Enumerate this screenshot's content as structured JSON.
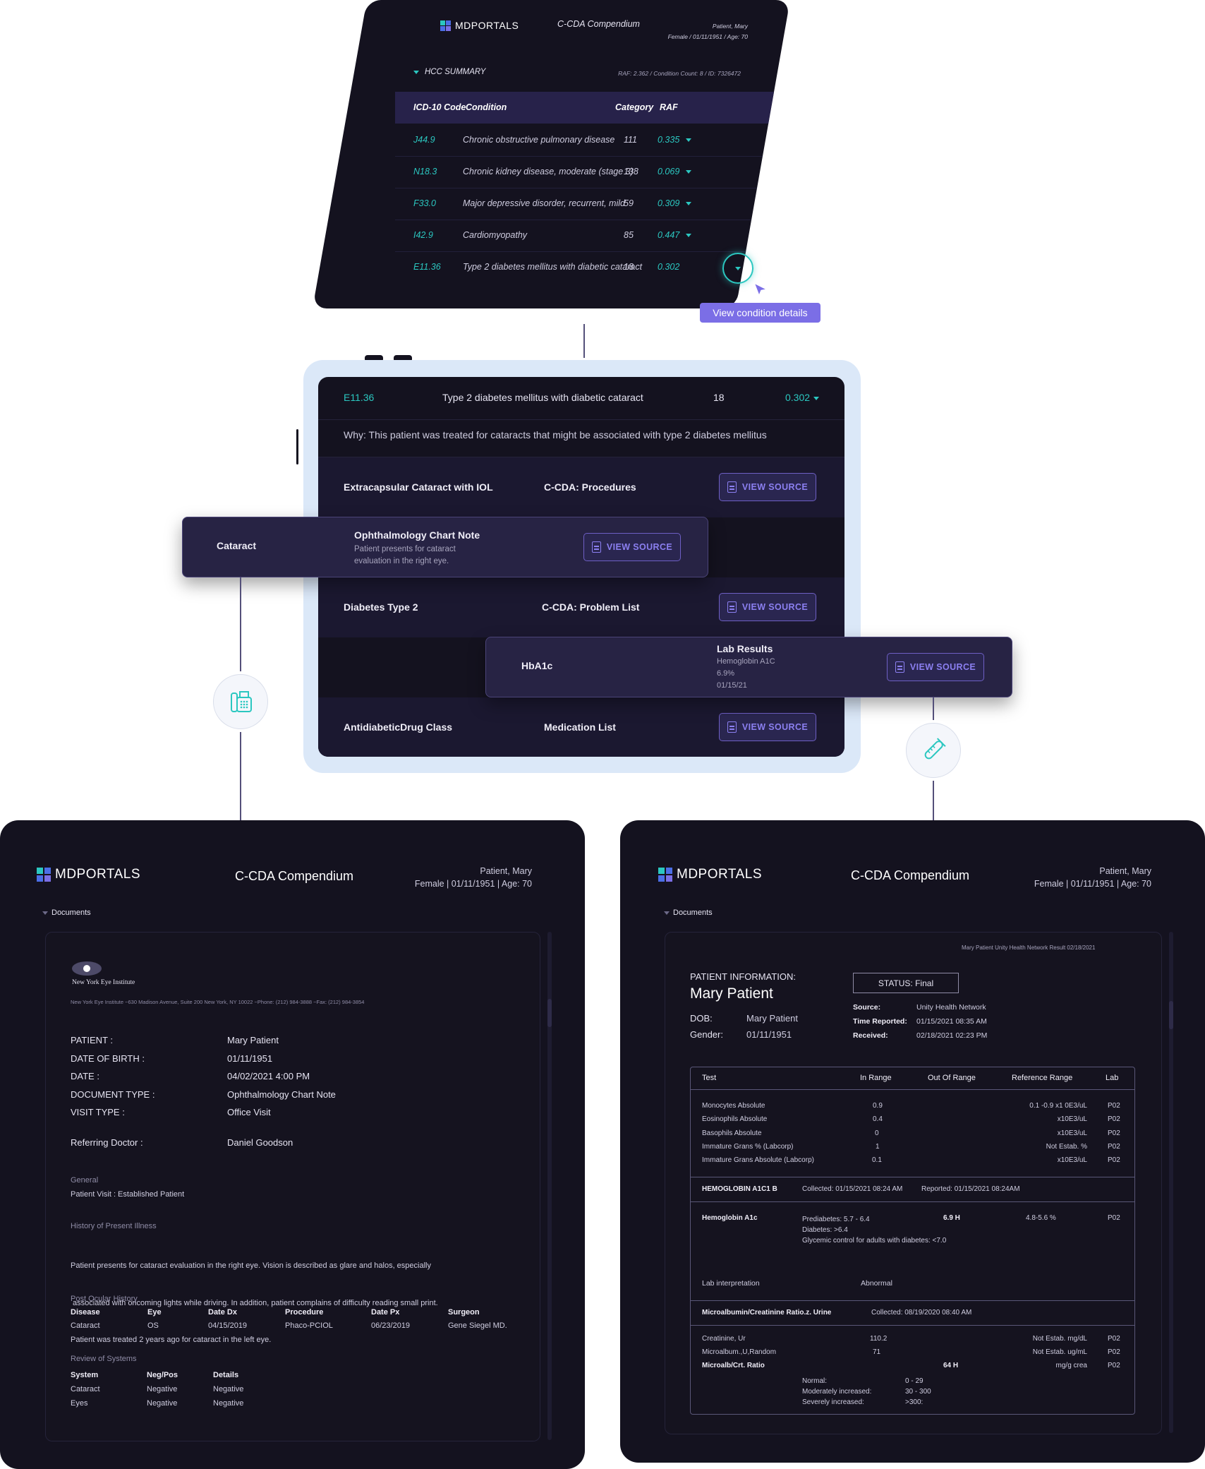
{
  "brand": {
    "name": "MDPORTALS",
    "colors": {
      "bg": "#14121f",
      "accent": "#2bc7c0",
      "purple": "#7b6ee6"
    }
  },
  "hcc": {
    "header_title": "C-CDA Compendium",
    "patient_name": "Patient, Mary",
    "patient_meta": "Female  /  01/11/1951  /  Age: 70",
    "section_label": "HCC SUMMARY",
    "summary_meta": "RAF: 2.362  /  Condition Count: 8  /  ID: 7326472",
    "columns": [
      "ICD-10 Code",
      "Condition",
      "Category",
      "RAF"
    ],
    "rows": [
      {
        "code": "J44.9",
        "condition": "Chronic obstructive pulmonary disease",
        "category": "111",
        "raf": "0.335"
      },
      {
        "code": "N18.3",
        "condition": "Chronic kidney disease, moderate (stage 3)",
        "category": "138",
        "raf": "0.069"
      },
      {
        "code": "F33.0",
        "condition": "Major depressive disorder, recurrent, mild",
        "category": "59",
        "raf": "0.309"
      },
      {
        "code": "I42.9",
        "condition": "Cardiomyopathy",
        "category": "85",
        "raf": "0.447"
      },
      {
        "code": "E11.36",
        "condition": "Type 2 diabetes mellitus with diabetic cataract",
        "category": "18",
        "raf": "0.302"
      }
    ],
    "tooltip": "View condition details"
  },
  "detail": {
    "code": "E11.36",
    "condition": "Type 2 diabetes mellitus with diabetic cataract",
    "category": "18",
    "raf": "0.302",
    "why": "Why: This patient was treated for cataracts that might be associated with type 2 diabetes mellitus",
    "view_source": "VIEW SOURCE",
    "evidence": [
      {
        "name": "Extracapsular Cataract with IOL",
        "source": "C-CDA: Procedures"
      },
      {
        "name": "Diabetes Type 2",
        "source": "C-CDA: Problem List"
      },
      {
        "name": "AntidiabeticDrug Class",
        "source": "Medication List"
      }
    ],
    "pop_cataract": {
      "name": "Cataract",
      "title": "Ophthalmology Chart Note",
      "line1": "Patient presents for cataract",
      "line2": "evaluation in the right eye."
    },
    "pop_hba1c": {
      "name": "HbA1c",
      "title": "Lab Results",
      "line1": "Hemoglobin A1C",
      "line2": "6.9%",
      "line3": "01/15/21"
    }
  },
  "doc_left": {
    "title": "C-CDA Compendium",
    "patient_name": "Patient, Mary",
    "patient_meta": "Female | 01/11/1951 | Age: 70",
    "documents": "Documents",
    "institute": "New York Eye Institute",
    "institute_address": "New York Eye Institute ~630 Madison Avenue, Suite 200 New York, NY 10022 ~Phone: (212) 984-3888 ~Fax: (212) 984-3854",
    "fields": [
      {
        "label": "PATIENT :",
        "value": "Mary Patient"
      },
      {
        "label": "DATE OF BIRTH :",
        "value": "01/11/1951"
      },
      {
        "label": "DATE :",
        "value": "04/02/2021 4:00 PM"
      },
      {
        "label": "DOCUMENT TYPE :",
        "value": "Ophthalmology Chart Note"
      },
      {
        "label": "VISIT TYPE :",
        "value": "Office Visit"
      }
    ],
    "referring_label": "Referring Doctor :",
    "referring_value": "Daniel Goodson",
    "general_label": "General",
    "general_value": "Patient Visit : Established Patient",
    "hpi_label": "History of Present Illness",
    "hpi_lines": [
      "Patient presents for cataract evaluation in the right eye. Vision is described as glare and halos, especially",
      " associated with oncoming lights while driving. In addition, patient complains of difficulty reading small print.",
      "Patient was treated 2 years ago for cataract in the left eye."
    ],
    "poh_label": "Post Ocular History",
    "poh_cols": [
      "Disease",
      "Eye",
      "Date Dx",
      "Procedure",
      "Date Px",
      "Surgeon"
    ],
    "poh_row": [
      "Cataract",
      "OS",
      "04/15/2019",
      "Phaco-PCIOL",
      "06/23/2019",
      "Gene Siegel MD."
    ],
    "ros_label": "Review of Systems",
    "ros_cols": [
      "System",
      "Neg/Pos",
      "Details"
    ],
    "ros_rows": [
      [
        "Cataract",
        "Negative",
        "Negative"
      ],
      [
        "Eyes",
        "Negative",
        "Negative"
      ]
    ]
  },
  "doc_right": {
    "title": "C-CDA Compendium",
    "patient_name": "Patient, Mary",
    "patient_meta": "Female | 01/11/1951 | Age: 70",
    "documents": "Documents",
    "result_header": "Mary Patient Unity Health Network Result 02/18/2021",
    "pi_label": "PATIENT INFORMATION:",
    "name": "Mary Patient",
    "dob_label": "DOB:",
    "dob_value": "Mary Patient",
    "gender_label": "Gender:",
    "gender_value": "01/11/1951",
    "status": "STATUS: Final",
    "source_label": "Source:",
    "source_value": "Unity Health Network",
    "time_label": "Time Reported:",
    "time_value": "01/15/2021 08:35 AM",
    "received_label": "Received:",
    "received_value": "02/18/2021 02:23 PM",
    "table_cols": [
      "Test",
      "In Range",
      "Out Of Range",
      "Reference Range",
      "Lab"
    ],
    "rows1": [
      [
        "Monocytes Absolute",
        "0.9",
        "",
        "0.1 -0.9 x1 0E3/uL",
        "P02"
      ],
      [
        "Eosinophils Absolute",
        "0.4",
        "",
        "x10E3/uL",
        "P02"
      ],
      [
        "Basophils Absolute",
        "0",
        "",
        "x10E3/uL",
        "P02"
      ],
      [
        "Immature Grans % (Labcorp)",
        "1",
        "",
        "Not Estab. %",
        "P02"
      ],
      [
        "Immature Grans Absolute (Labcorp)",
        "0.1",
        "",
        "x10E3/uL",
        "P02"
      ]
    ],
    "hba1c_section": "HEMOGLOBIN A1C1 B",
    "hba1c_collected": "Collected: 01/15/2021 08:24 AM",
    "hba1c_reported": "Reported: 01/15/2021 08:24AM",
    "hba1c_test": "Hemoglobin A1c",
    "hba1c_notes": [
      "Prediabetes: 5.7 - 6.4",
      "Diabetes: >6.4",
      "Glycemic control for adults with diabetes: <7.0"
    ],
    "hba1c_value": "6.9 H",
    "hba1c_range": "4.8-5.6 %",
    "hba1c_lab": "P02",
    "interp_label": "Lab interpretation",
    "interp_value": "Abnormal",
    "micro_section": "Microalbumin/Creatinine Ratio.z. Urine",
    "micro_collected": "Collected: 08/19/2020 08:40 AM",
    "rows2": [
      [
        "Creatinine, Ur",
        "110.2",
        "",
        "Not Estab. mg/dL",
        "P02"
      ],
      [
        "Microalbum.,U,Random",
        "71",
        "",
        "Not Estab. ug/mL",
        "P02"
      ],
      [
        "Microalb/Crt. Ratio",
        "",
        "64 H",
        "mg/g crea",
        "P02"
      ]
    ],
    "ratio_notes": [
      [
        "Normal:",
        "0 - 29"
      ],
      [
        "Moderately increased:",
        "30 - 300"
      ],
      [
        "Severely increased:",
        ">300:"
      ]
    ]
  }
}
